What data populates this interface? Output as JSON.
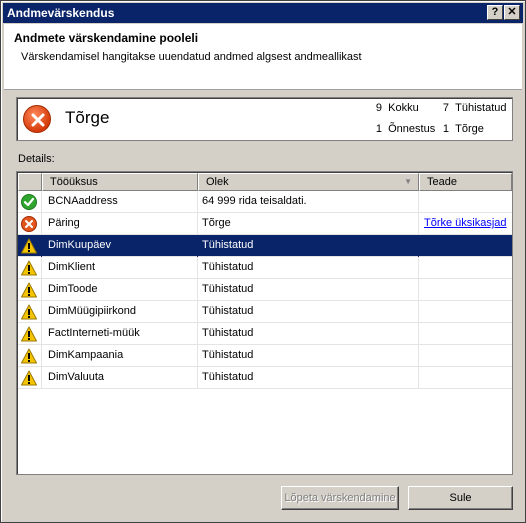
{
  "window": {
    "title": "Andmevärskendus",
    "help_glyph": "?",
    "close_glyph": "✕"
  },
  "header": {
    "title": "Andmete värskendamine pooleli",
    "description": "Värskendamisel hangitakse uuendatud andmed algsest andmeallikast"
  },
  "status": {
    "label": "Tõrge",
    "icon": "error-icon",
    "stats": [
      {
        "count": "9",
        "label": "Kokku"
      },
      {
        "count": "7",
        "label": "Tühistatud"
      },
      {
        "count": "1",
        "label": "Õnnestus"
      },
      {
        "count": "1",
        "label": "Tõrge"
      }
    ]
  },
  "details": {
    "label": "Details:",
    "columns": [
      "Tööüksus",
      "Olek",
      "Teade"
    ],
    "rows": [
      {
        "icon": "success-icon",
        "task": "BCNAaddress",
        "state": "64 999 rida teisaldati.",
        "message": ""
      },
      {
        "icon": "error-icon",
        "task": "Päring",
        "state": "Tõrge",
        "message": "Tõrke üksikasjad"
      },
      {
        "icon": "warning-icon",
        "task": "DimKuupäev",
        "state": "Tühistatud",
        "message": ""
      },
      {
        "icon": "warning-icon",
        "task": "DimKlient",
        "state": "Tühistatud",
        "message": ""
      },
      {
        "icon": "warning-icon",
        "task": "DimToode",
        "state": "Tühistatud",
        "message": ""
      },
      {
        "icon": "warning-icon",
        "task": "DimMüügipiirkond",
        "state": "Tühistatud",
        "message": ""
      },
      {
        "icon": "warning-icon",
        "task": "FactInterneti-müük",
        "state": "Tühistatud",
        "message": ""
      },
      {
        "icon": "warning-icon",
        "task": "DimKampaania",
        "state": "Tühistatud",
        "message": ""
      },
      {
        "icon": "warning-icon",
        "task": "DimValuuta",
        "state": "Tühistatud",
        "message": ""
      }
    ],
    "selected_index": 2
  },
  "buttons": {
    "stop": "Lõpeta värskendamine",
    "close": "Sule"
  },
  "colors": {
    "selection": "#0a246a",
    "link": "#0000ff",
    "success": "#2fa52f",
    "error": "#d63a0a",
    "warning": "#f5c400"
  }
}
